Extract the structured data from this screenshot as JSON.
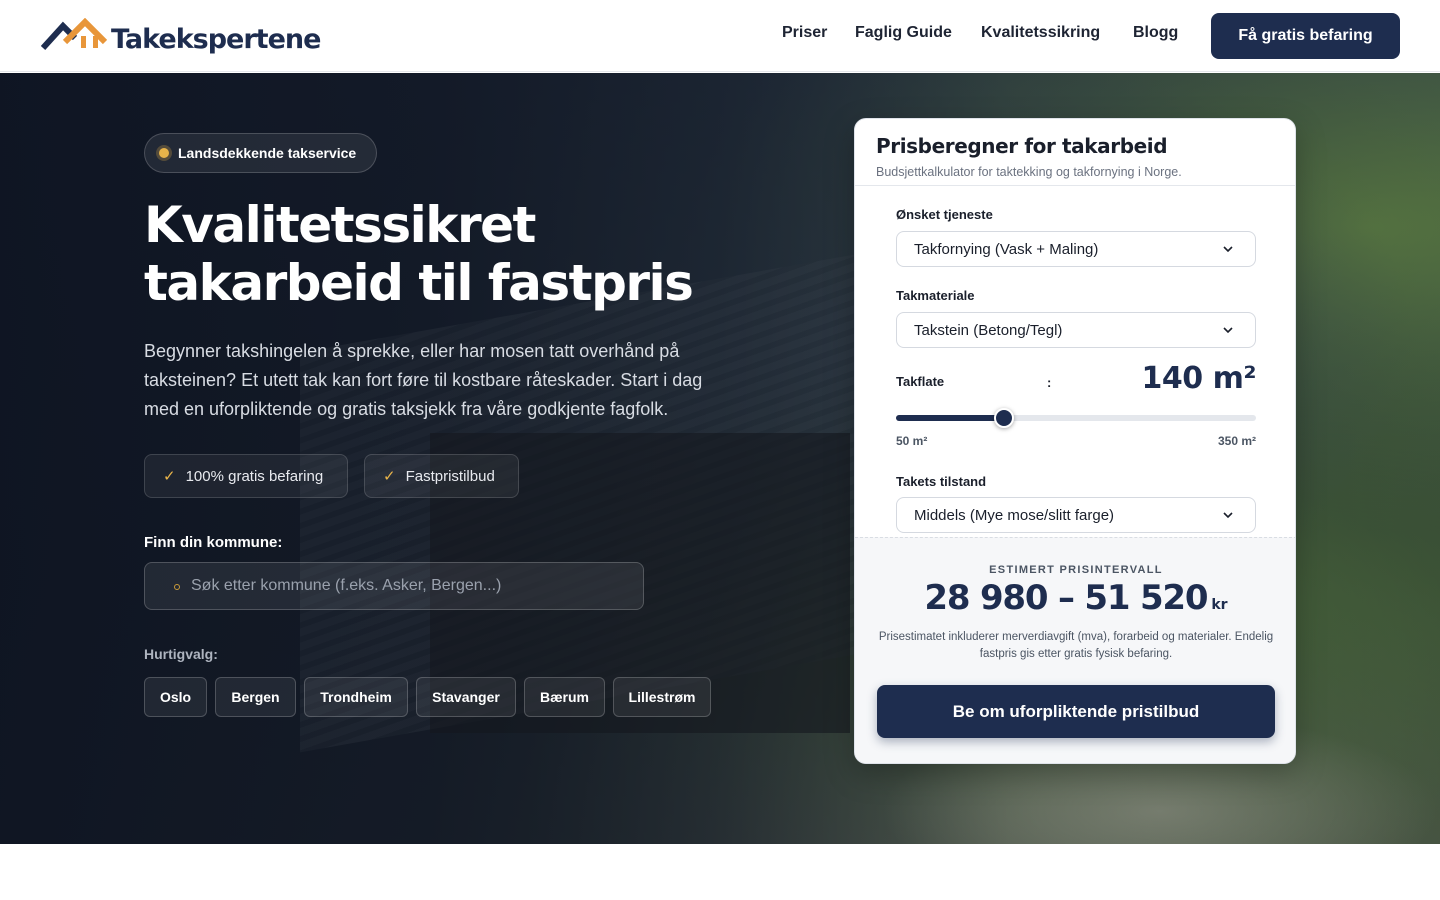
{
  "brand": {
    "name": "Takekspertene",
    "color_primary": "#1e2d4f",
    "color_accent": "#e8963a"
  },
  "nav": {
    "items": [
      "Priser",
      "Faglig Guide",
      "Kvalitetssikring",
      "Blogg"
    ],
    "cta": "Få gratis befaring"
  },
  "hero": {
    "badge": "Landsdekkende takservice",
    "title_line1": "Kvalitetssikret",
    "title_line2": "takarbeid til fastpris",
    "description": "Begynner takshingelen å sprekke, eller har mosen tatt overhånd på taksteinen? Et utett tak kan fort føre til kostbare råteskader. Start i dag med en uforpliktende og gratis taksjekk fra våre godkjente fagfolk.",
    "features": [
      "100% gratis befaring",
      "Fastpristilbud"
    ],
    "search_label": "Finn din kommune:",
    "search_placeholder": "Søk etter kommune (f.eks. Asker, Bergen...)",
    "search_value": "",
    "quick_label": "Hurtigvalg:",
    "quick_choices": [
      "Oslo",
      "Bergen",
      "Trondheim",
      "Stavanger",
      "Bærum",
      "Lillestrøm"
    ]
  },
  "calculator": {
    "title": "Prisberegner for takarbeid",
    "subtitle": "Budsjettkalkulator for taktekking og takfornying i Norge.",
    "service_label": "Ønsket tjeneste",
    "service_value": "Takfornying (Vask + Maling)",
    "material_label": "Takmateriale",
    "material_value": "Takstein (Betong/Tegl)",
    "area_label": "Takflate",
    "area_separator": ":",
    "area_value": "140 m²",
    "area_current": 140,
    "area_min": 50,
    "area_max": 350,
    "area_min_label": "50 m²",
    "area_max_label": "350 m²",
    "condition_label": "Takets tilstand",
    "condition_value": "Middels (Mye mose/slitt farge)",
    "estimate_label": "ESTIMERT PRISINTERVALL",
    "estimate_value": "28 980 – 51 520",
    "estimate_unit": "kr",
    "estimate_note": "Prisestimatet inkluderer merverdiavgift (mva), forarbeid og materialer. Endelig fastpris gis etter gratis fysisk befaring.",
    "cta": "Be om uforpliktende pristilbud"
  }
}
